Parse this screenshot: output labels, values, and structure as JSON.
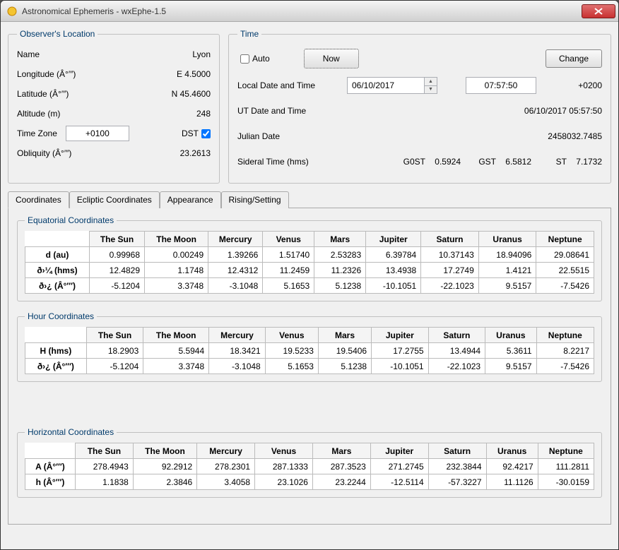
{
  "window": {
    "title": "Astronomical Ephemeris - wxEphe-1.5"
  },
  "observer": {
    "legend": "Observer's Location",
    "name_lbl": "Name",
    "name_val": "Lyon",
    "lon_lbl": "Longitude (Â°′″)",
    "lon_val": "E   4.5000",
    "lat_lbl": "Latitude (Â°′″)",
    "lat_val": "N  45.4600",
    "alt_lbl": "Altitude (m)",
    "alt_val": "248",
    "tz_lbl": "Time Zone",
    "tz_val": "+0100",
    "dst_lbl": "DST",
    "obl_lbl": "Obliquity (Â°′″)",
    "obl_val": "23.2613"
  },
  "time": {
    "legend": "Time",
    "auto_lbl": "Auto",
    "now_btn": "Now",
    "change_btn": "Change",
    "local_lbl": "Local Date and Time",
    "local_date": "06/10/2017",
    "local_time": "07:57:50",
    "tz_off": "+0200",
    "ut_lbl": "UT Date and Time",
    "ut_val": "06/10/2017 05:57:50",
    "jd_lbl": "Julian Date",
    "jd_val": "2458032.7485",
    "sid_lbl": "Sideral Time (hms)",
    "g0st_lbl": "G0ST",
    "g0st_val": "0.5924",
    "gst_lbl": "GST",
    "gst_val": "6.5812",
    "st_lbl": "ST",
    "st_val": "7.1732"
  },
  "tabs": {
    "t1": "Coordinates",
    "t2": "Ecliptic Coordinates",
    "t3": "Appearance",
    "t4": "Rising/Setting"
  },
  "bodies": [
    "The Sun",
    "The Moon",
    "Mercury",
    "Venus",
    "Mars",
    "Jupiter",
    "Saturn",
    "Uranus",
    "Neptune"
  ],
  "equatorial": {
    "legend": "Equatorial Coordinates",
    "rows": [
      {
        "hdr": "d (au)",
        "v": [
          "0.99968",
          "0.00249",
          "1.39266",
          "1.51740",
          "2.53283",
          "6.39784",
          "10.37143",
          "18.94096",
          "29.08641"
        ]
      },
      {
        "hdr": "ð›¼ (hms)",
        "v": [
          "12.4829",
          "1.1748",
          "12.4312",
          "11.2459",
          "11.2326",
          "13.4938",
          "17.2749",
          "1.4121",
          "22.5515"
        ]
      },
      {
        "hdr": "ð›¿ (Â°′″)",
        "v": [
          "-5.1204",
          "3.3748",
          "-3.1048",
          "5.1653",
          "5.1238",
          "-10.1051",
          "-22.1023",
          "9.5157",
          "-7.5426"
        ]
      }
    ]
  },
  "hour": {
    "legend": "Hour Coordinates",
    "rows": [
      {
        "hdr": "H (hms)",
        "v": [
          "18.2903",
          "5.5944",
          "18.3421",
          "19.5233",
          "19.5406",
          "17.2755",
          "13.4944",
          "5.3611",
          "8.2217"
        ]
      },
      {
        "hdr": "ð›¿ (Â°′″)",
        "v": [
          "-5.1204",
          "3.3748",
          "-3.1048",
          "5.1653",
          "5.1238",
          "-10.1051",
          "-22.1023",
          "9.5157",
          "-7.5426"
        ]
      }
    ]
  },
  "horizontal": {
    "legend": "Horizontal Coordinates",
    "rows": [
      {
        "hdr": "A (Â°′″)",
        "v": [
          "278.4943",
          "92.2912",
          "278.2301",
          "287.1333",
          "287.3523",
          "271.2745",
          "232.3844",
          "92.4217",
          "111.2811"
        ]
      },
      {
        "hdr": "h (Â°′″)",
        "v": [
          "1.1838",
          "2.3846",
          "3.4058",
          "23.1026",
          "23.2244",
          "-12.5114",
          "-57.3227",
          "11.1126",
          "-30.0159"
        ]
      }
    ]
  }
}
